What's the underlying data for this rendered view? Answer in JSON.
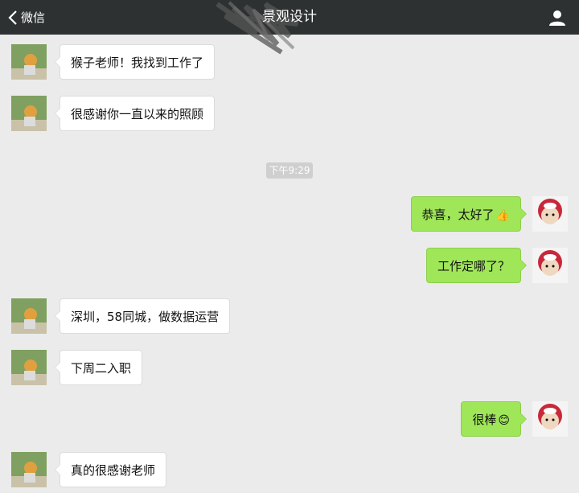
{
  "header": {
    "back_label": "微信",
    "title": "景观设计",
    "back_icon": "chevron-left-icon",
    "user_icon": "user-icon"
  },
  "timestamp": "下午9:29",
  "messages": [
    {
      "side": "in",
      "text": "猴子老师！我找到工作了"
    },
    {
      "side": "in",
      "text": "很感谢你一直以来的照顾"
    },
    {
      "side": "out",
      "text": "恭喜，太好了",
      "emoji": "👍"
    },
    {
      "side": "out",
      "text": "工作定哪了？"
    },
    {
      "side": "in",
      "text": "深圳，58同城，做数据运营"
    },
    {
      "side": "in",
      "text": "下周二入职"
    },
    {
      "side": "out",
      "text": "很棒",
      "emoji": "😊"
    },
    {
      "side": "in",
      "text": "真的很感谢老师"
    }
  ],
  "colors": {
    "header_bg": "#2e3132",
    "chat_bg": "#ebebeb",
    "bubble_out": "#9fe658",
    "bubble_in": "#ffffff"
  }
}
